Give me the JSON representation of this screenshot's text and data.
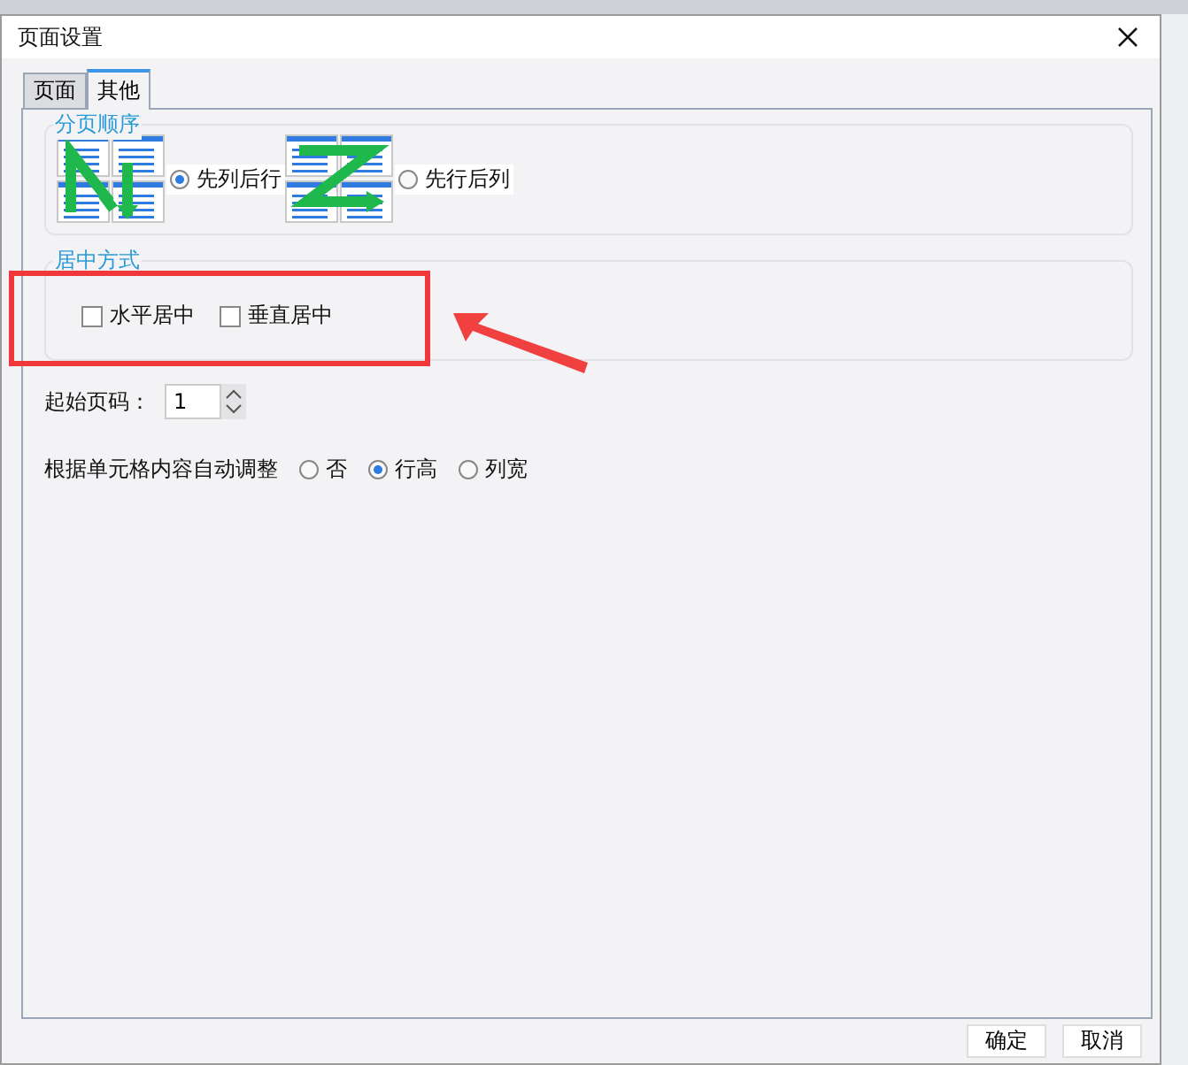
{
  "window": {
    "title": "页面设置"
  },
  "tabs": [
    {
      "label": "页面",
      "selected": false
    },
    {
      "label": "其他",
      "selected": true
    }
  ],
  "page_order": {
    "title": "分页顺序",
    "options": [
      {
        "label": "先列后行",
        "kind": "n",
        "selected": true
      },
      {
        "label": "先行后列",
        "kind": "z",
        "selected": false
      }
    ]
  },
  "centering": {
    "title": "居中方式",
    "options": [
      {
        "label": "水平居中",
        "checked": false
      },
      {
        "label": "垂直居中",
        "checked": false
      }
    ]
  },
  "start_page": {
    "label": "起始页码：",
    "value": "1"
  },
  "auto_adjust": {
    "label": "根据单元格内容自动调整",
    "options": [
      {
        "label": "否",
        "selected": false
      },
      {
        "label": "行高",
        "selected": true
      },
      {
        "label": "列宽",
        "selected": false
      }
    ]
  },
  "buttons": [
    "确定",
    "取消"
  ]
}
